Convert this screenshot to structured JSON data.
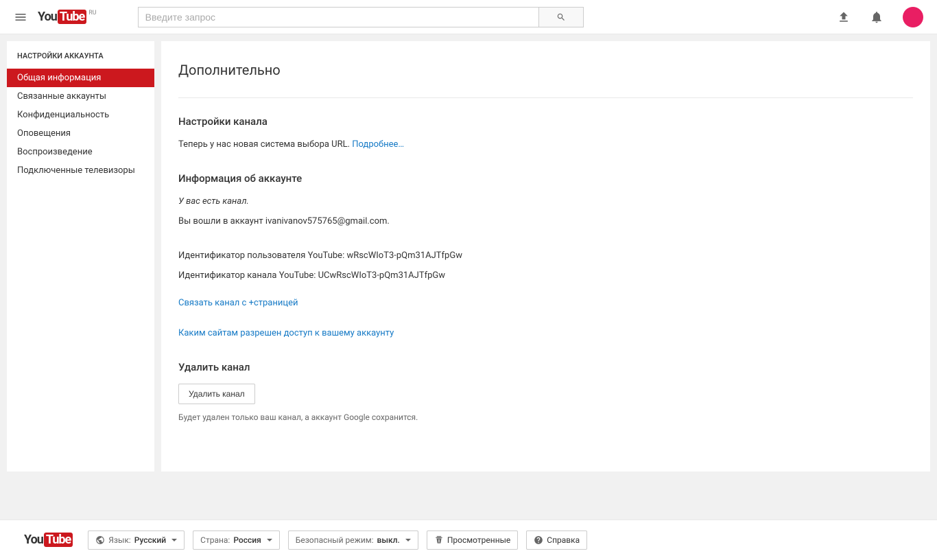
{
  "header": {
    "logo_region": "RU",
    "search_placeholder": "Введите запрос"
  },
  "sidebar": {
    "title": "НАСТРОЙКИ АККАУНТА",
    "items": [
      {
        "label": "Общая информация",
        "active": true
      },
      {
        "label": "Связанные аккаунты",
        "active": false
      },
      {
        "label": "Конфиденциальность",
        "active": false
      },
      {
        "label": "Оповещения",
        "active": false
      },
      {
        "label": "Воспроизведение",
        "active": false
      },
      {
        "label": "Подключенные телевизоры",
        "active": false
      }
    ]
  },
  "main": {
    "title": "Дополнительно",
    "channel_settings": {
      "heading": "Настройки канала",
      "text": "Теперь у нас новая система выбора URL. ",
      "link": "Подробнее…"
    },
    "account_info": {
      "heading": "Информация об аккаунте",
      "has_channel": "У вас есть канал.",
      "signed_in": "Вы вошли в аккаунт ivanivanov575765@gmail.com.",
      "user_id": "Идентификатор пользователя YouTube: wRscWIoT3-pQm31AJTfpGw",
      "channel_id": "Идентификатор канала YouTube: UCwRscWIoT3-pQm31AJTfpGw",
      "link_plus": "Связать канал с +страницей",
      "sites_access": "Каким сайтам разрешен доступ к вашему аккаунту"
    },
    "delete": {
      "heading": "Удалить канал",
      "button": "Удалить канал",
      "note": "Будет удален только ваш канал, а аккаунт Google сохранится."
    }
  },
  "footer": {
    "language_label": "Язык:",
    "language_value": "Русский",
    "country_label": "Страна:",
    "country_value": "Россия",
    "safemode_label": "Безопасный режим:",
    "safemode_value": "выкл.",
    "history": "Просмотренные",
    "help": "Справка"
  }
}
